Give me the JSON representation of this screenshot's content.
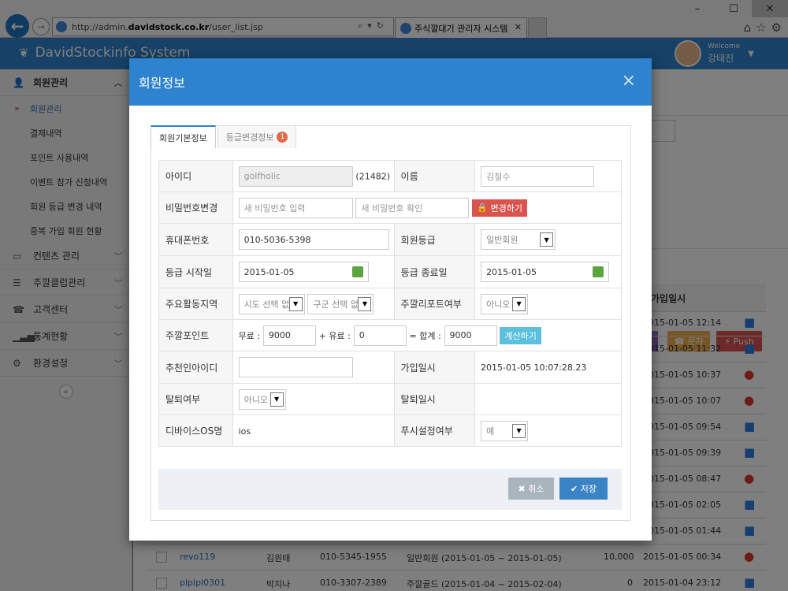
{
  "browser": {
    "url_prefix": "http://admin.",
    "url_host": "davidstock.co.kr",
    "url_path": "/user_list.jsp",
    "tab_title": "주식깔대기 관리자 시스템"
  },
  "app": {
    "logo": "DavidStockinfo System",
    "welcome": "Welcome",
    "user_name": "강태진"
  },
  "sidebar": {
    "groups": [
      {
        "label": "회원관리"
      },
      {
        "label": "컨텐츠 관리"
      },
      {
        "label": "주깔클럽관리"
      },
      {
        "label": "고객센터"
      },
      {
        "label": "통계현황"
      },
      {
        "label": "환경설정"
      }
    ],
    "sub_items": [
      "회원관리",
      "결제내역",
      "포인트 사용내역",
      "이벤트 참가 신청내역",
      "회원 등급 변경 내역",
      "중복 가입 회원 현황"
    ]
  },
  "background": {
    "btn_sms": "문자",
    "btn_push": "Push",
    "col_join_date": "가입일시",
    "rows": [
      {
        "date": "2015-01-05 12:14",
        "os": "android"
      },
      {
        "date": "2015-01-05 11:32",
        "os": "android"
      },
      {
        "date": "2015-01-05 10:37",
        "os": "ios"
      },
      {
        "date": "2015-01-05 10:07",
        "os": "ios"
      },
      {
        "date": "2015-01-05 09:54",
        "os": "android"
      },
      {
        "date": "2015-01-05 09:39",
        "os": "android"
      },
      {
        "date": "2015-01-05 08:47",
        "os": "ios"
      },
      {
        "date": "2015-01-05 02:05",
        "os": "android"
      },
      {
        "date": "2015-01-05 01:44",
        "os": "android"
      }
    ],
    "row_a": {
      "id": "revo119",
      "name": "김원태",
      "phone": "010-5345-1955",
      "grade": "일반회원 (2015-01-05 ~ 2015-01-05)",
      "points": "10,000",
      "date": "2015-01-05 00:34"
    },
    "row_b": {
      "id": "plplpl0301",
      "name": "박지나",
      "phone": "010-3307-2389",
      "grade": "주깔골드 (2015-01-04 ~ 2015-02-04)",
      "points": "0",
      "date": "2015-01-04 23:12"
    }
  },
  "modal": {
    "title": "회원정보",
    "close": "×",
    "tab_basic": "회원기본정보",
    "tab_grade": "등급변경정보",
    "tab_grade_badge": "1",
    "labels": {
      "id": "아이디",
      "name": "이름",
      "password": "비밀번호변경",
      "phone": "휴대폰번호",
      "grade": "회원등급",
      "start": "등급 시작일",
      "end": "등급 종료일",
      "region": "주요활동지역",
      "report": "주깔리포트여부",
      "points": "주깔포인트",
      "referrer": "추천인아이디",
      "join": "가입일시",
      "withdraw": "탈퇴여부",
      "withdraw_date": "탈퇴일시",
      "device_os": "디바이스OS명",
      "push": "푸시설정여부"
    },
    "values": {
      "id": "golfholic",
      "id_no": "(21482)",
      "name": "김철수",
      "pw_new_placeholder": "새 비밀번호 입력",
      "pw_confirm_placeholder": "새 비밀번호 확인",
      "pw_change_btn": "변경하기",
      "phone": "010-5036-5398",
      "grade": "일반회원",
      "start": "2015-01-05",
      "end": "2015-01-05",
      "region_sido": "시도 선택 없",
      "region_gugun": "구군 선택 없",
      "report": "아니오",
      "points_free_label": "무료 :",
      "points_free": "9000",
      "points_paid_label": "+ 유료 :",
      "points_paid": "0",
      "points_total_label": "= 합계 :",
      "points_total": "9000",
      "calc_btn": "계산하기",
      "referrer": "",
      "join": "2015-01-05 10:07:28.23",
      "withdraw": "아니오",
      "withdraw_date": "",
      "device_os": "ios",
      "push": "예"
    },
    "btn_cancel": "취소",
    "btn_save": "저장"
  }
}
